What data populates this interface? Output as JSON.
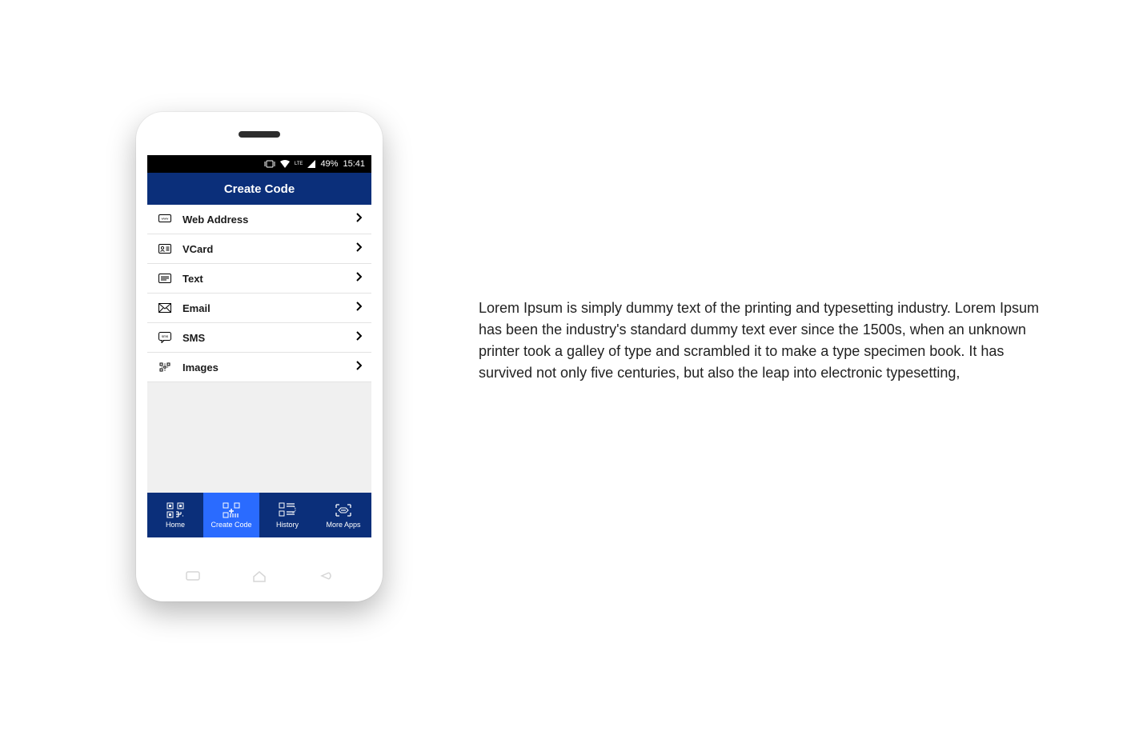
{
  "colors": {
    "brand": "#0b2f7a",
    "accent": "#2a6bff",
    "statusbar": "#000000"
  },
  "statusBar": {
    "battery": "49%",
    "time": "15:41",
    "network": "LTE"
  },
  "header": {
    "title": "Create Code"
  },
  "list": [
    {
      "label": "Web Address",
      "icon": "www-icon"
    },
    {
      "label": "VCard",
      "icon": "vcard-icon"
    },
    {
      "label": "Text",
      "icon": "text-icon"
    },
    {
      "label": "Email",
      "icon": "email-icon"
    },
    {
      "label": "SMS",
      "icon": "sms-icon"
    },
    {
      "label": "Images",
      "icon": "images-icon"
    }
  ],
  "bottomNav": [
    {
      "label": "Home",
      "icon": "qr-home-icon",
      "active": false
    },
    {
      "label": "Create Code",
      "icon": "qr-create-icon",
      "active": true
    },
    {
      "label": "History",
      "icon": "qr-history-icon",
      "active": false
    },
    {
      "label": "More Apps",
      "icon": "more-apps-icon",
      "active": false
    }
  ],
  "description": "Lorem Ipsum is simply dummy text of the printing and typesetting industry. Lorem Ipsum has been the industry's standard dummy text ever since the 1500s, when an unknown printer took a galley of type and scrambled it to make a type specimen book. It has survived not only five centuries, but also the leap into electronic typesetting,"
}
